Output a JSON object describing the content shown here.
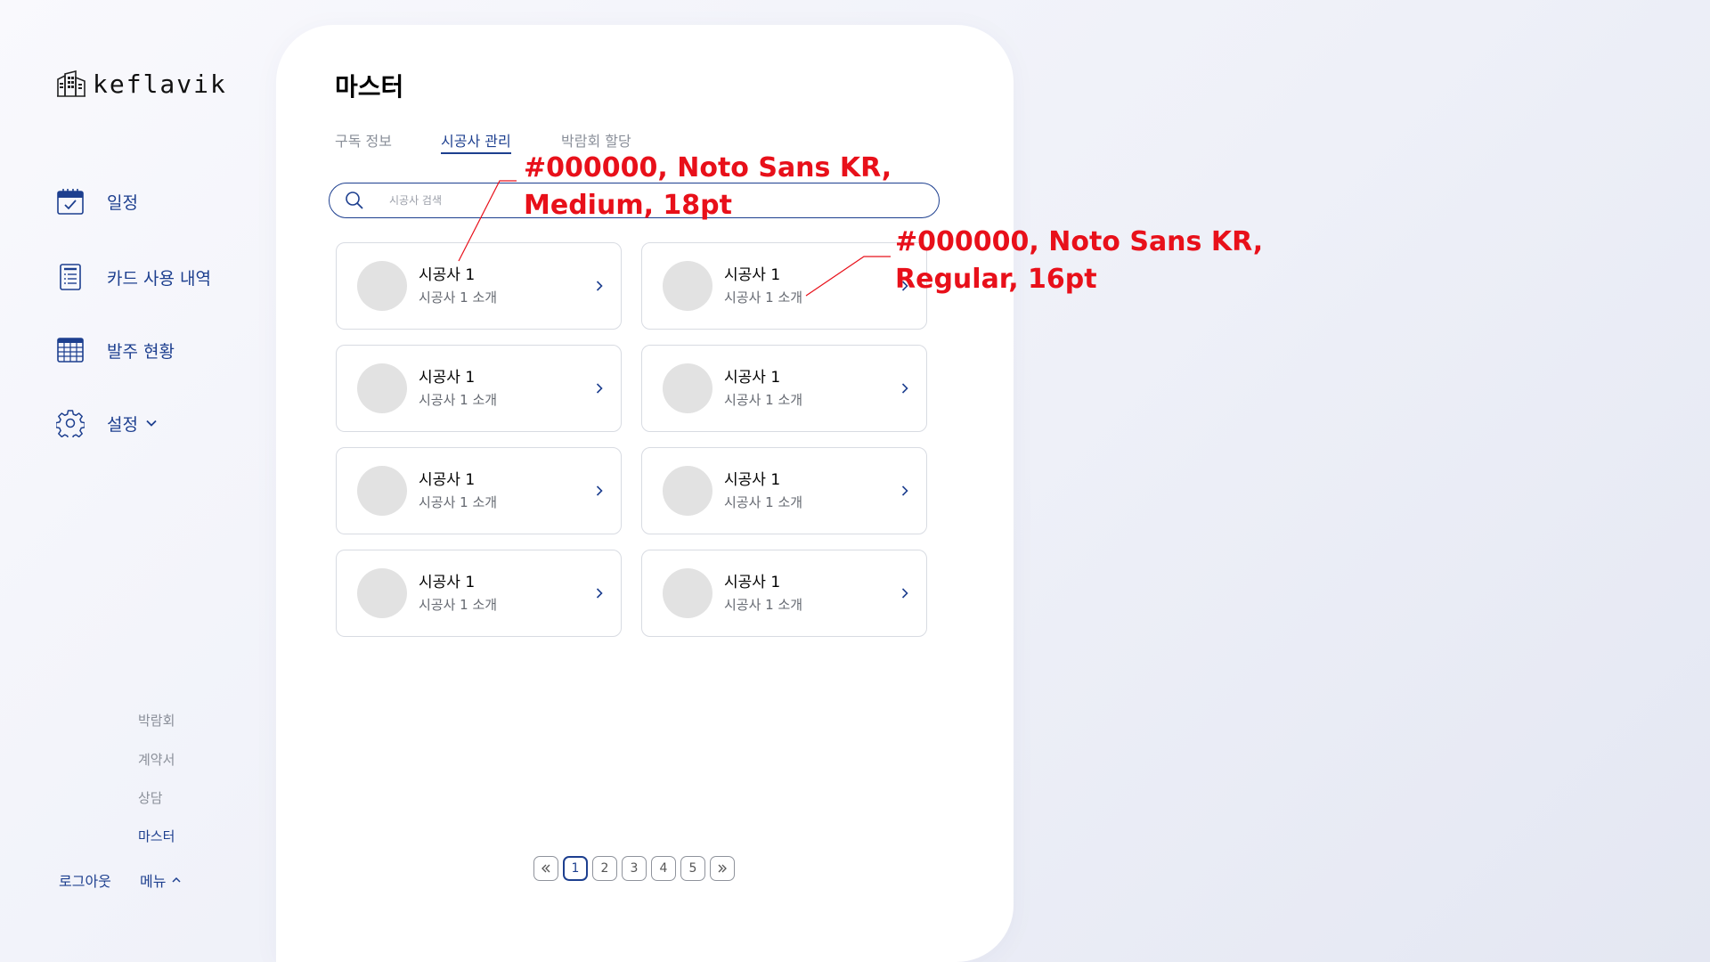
{
  "sidebar": {
    "logo_text": "keflavik",
    "nav": [
      {
        "label": "일정",
        "icon": "calendar-check-icon"
      },
      {
        "label": "카드 사용 내역",
        "icon": "card-receipt-icon"
      },
      {
        "label": "발주 현황",
        "icon": "table-grid-icon"
      },
      {
        "label": "설정",
        "icon": "gear-icon",
        "expand_icon": "chevron-down-icon"
      }
    ],
    "sub_menu": [
      "박람회",
      "계약서",
      "상담",
      "마스터"
    ],
    "active_sub": "마스터",
    "logout_label": "로그아웃",
    "menu_label": "메뉴",
    "menu_icon": "chevron-up-icon"
  },
  "main": {
    "title": "마스터",
    "tabs": [
      {
        "label": "구독 정보",
        "active": false
      },
      {
        "label": "시공사 관리",
        "active": true
      },
      {
        "label": "박람회 할당",
        "active": false
      }
    ],
    "search": {
      "placeholder": "시공사 검색",
      "value": "",
      "icon": "search-icon"
    },
    "cards": [
      {
        "name": "시공사 1",
        "desc": "시공사 1 소개"
      },
      {
        "name": "시공사 1",
        "desc": "시공사 1 소개"
      },
      {
        "name": "시공사 1",
        "desc": "시공사 1 소개"
      },
      {
        "name": "시공사 1",
        "desc": "시공사 1 소개"
      },
      {
        "name": "시공사 1",
        "desc": "시공사 1 소개"
      },
      {
        "name": "시공사 1",
        "desc": "시공사 1 소개"
      },
      {
        "name": "시공사 1",
        "desc": "시공사 1 소개"
      },
      {
        "name": "시공사 1",
        "desc": "시공사 1 소개"
      }
    ],
    "pagination": {
      "first_icon": "double-chevron-left-icon",
      "last_icon": "double-chevron-right-icon",
      "pages": [
        "1",
        "2",
        "3",
        "4",
        "5"
      ],
      "current": "1"
    }
  },
  "annotations": [
    {
      "lines": [
        "#000000, Noto Sans KR,",
        "Medium, 18pt"
      ]
    },
    {
      "lines": [
        "#000000, Noto Sans KR,",
        "Regular, 16pt"
      ]
    }
  ],
  "colors": {
    "accent": "#1d3f8f",
    "annotation": "#e8101a",
    "avatar": "#e2e2e2",
    "muted_text": "#8a8f99",
    "card_border": "#d8dbe2"
  }
}
